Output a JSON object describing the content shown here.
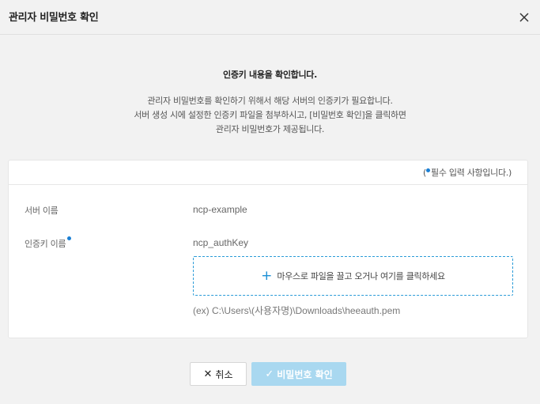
{
  "dialog": {
    "title": "관리자 비밀번호 확인",
    "close_icon": "close-icon"
  },
  "intro": {
    "title": "인증키 내용을 확인합니다.",
    "lines": [
      "관리자 비밀번호를 확인하기 위해서 해당 서버의 인증키가 필요합니다.",
      "서버 생성 시에 설정한 인증키 파일을 첨부하시고, [비밀번호 확인]을 클릭하면",
      "관리자 비밀번호가 제공됩니다."
    ]
  },
  "form": {
    "required_prefix": "(",
    "required_text": "필수 입력 사항입니다.)",
    "required_dot_color": "#1a7fd4",
    "server_name_label": "서버 이름",
    "server_name_value": "ncp-example",
    "auth_key_label": "인증키 이름",
    "auth_key_value": "ncp_authKey",
    "dropzone_icon": "plus-icon",
    "dropzone_text": "마우스로 파일을 끌고 오거나 여기를 클릭하세요",
    "example_path": "(ex) C:\\Users\\(사용자명)\\Downloads\\heeauth.pem"
  },
  "buttons": {
    "cancel_icon": "x-icon",
    "cancel_label": "취소",
    "confirm_icon": "check-icon",
    "confirm_label": "비밀번호 확인",
    "confirm_color": "#a9d8f0"
  }
}
